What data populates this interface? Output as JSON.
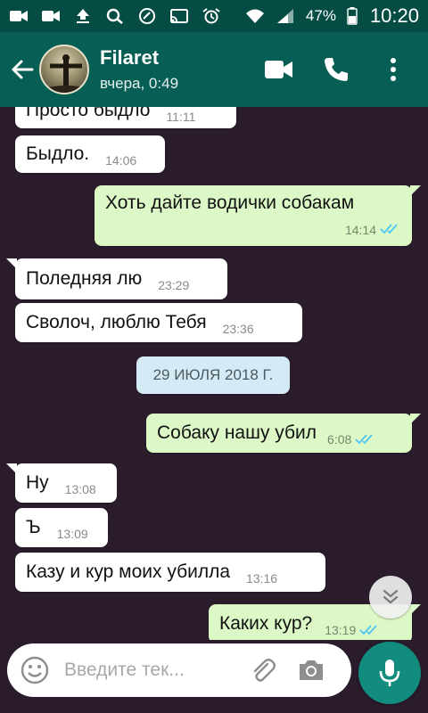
{
  "status_bar": {
    "icons": [
      "video-icon",
      "video-icon",
      "upload-icon",
      "search-icon",
      "sync-icon",
      "cast-icon",
      "alarm-icon",
      "wifi-icon",
      "signal-icon"
    ],
    "battery_percent": "47%",
    "time": "10:20"
  },
  "header": {
    "contact_name": "Filaret",
    "last_seen": "вчера, 0:49"
  },
  "messages": [
    {
      "text": "Просто быдло",
      "time": "11:11",
      "direction": "in"
    },
    {
      "text": "Быдло.",
      "time": "14:06",
      "direction": "in"
    },
    {
      "text": "Хоть дайте водички собакам",
      "time": "14:14",
      "direction": "out"
    },
    {
      "text": "Поледняя лю",
      "time": "23:29",
      "direction": "in"
    },
    {
      "text": "Сволоч, люблю Тебя",
      "time": "23:36",
      "direction": "in"
    },
    {
      "text": "Собаку нашу убил",
      "time": "6:08",
      "direction": "out"
    },
    {
      "text": "Ну",
      "time": "13:08",
      "direction": "in"
    },
    {
      "text": "Ъ",
      "time": "13:09",
      "direction": "in"
    },
    {
      "text": "Казу и кур моих убилла",
      "time": "13:16",
      "direction": "in"
    },
    {
      "text": "Каких кур?",
      "time": "13:19",
      "direction": "out"
    }
  ],
  "date_divider": "29 ИЮЛЯ 2018 Г.",
  "input": {
    "placeholder": "Введите тек..."
  },
  "colors": {
    "header": "#075e54",
    "status_bar": "#054d44",
    "outgoing_bubble": "#dcf8c6",
    "incoming_bubble": "#ffffff",
    "read_ticks": "#4fc3f7",
    "mic_button": "#128c7e"
  }
}
